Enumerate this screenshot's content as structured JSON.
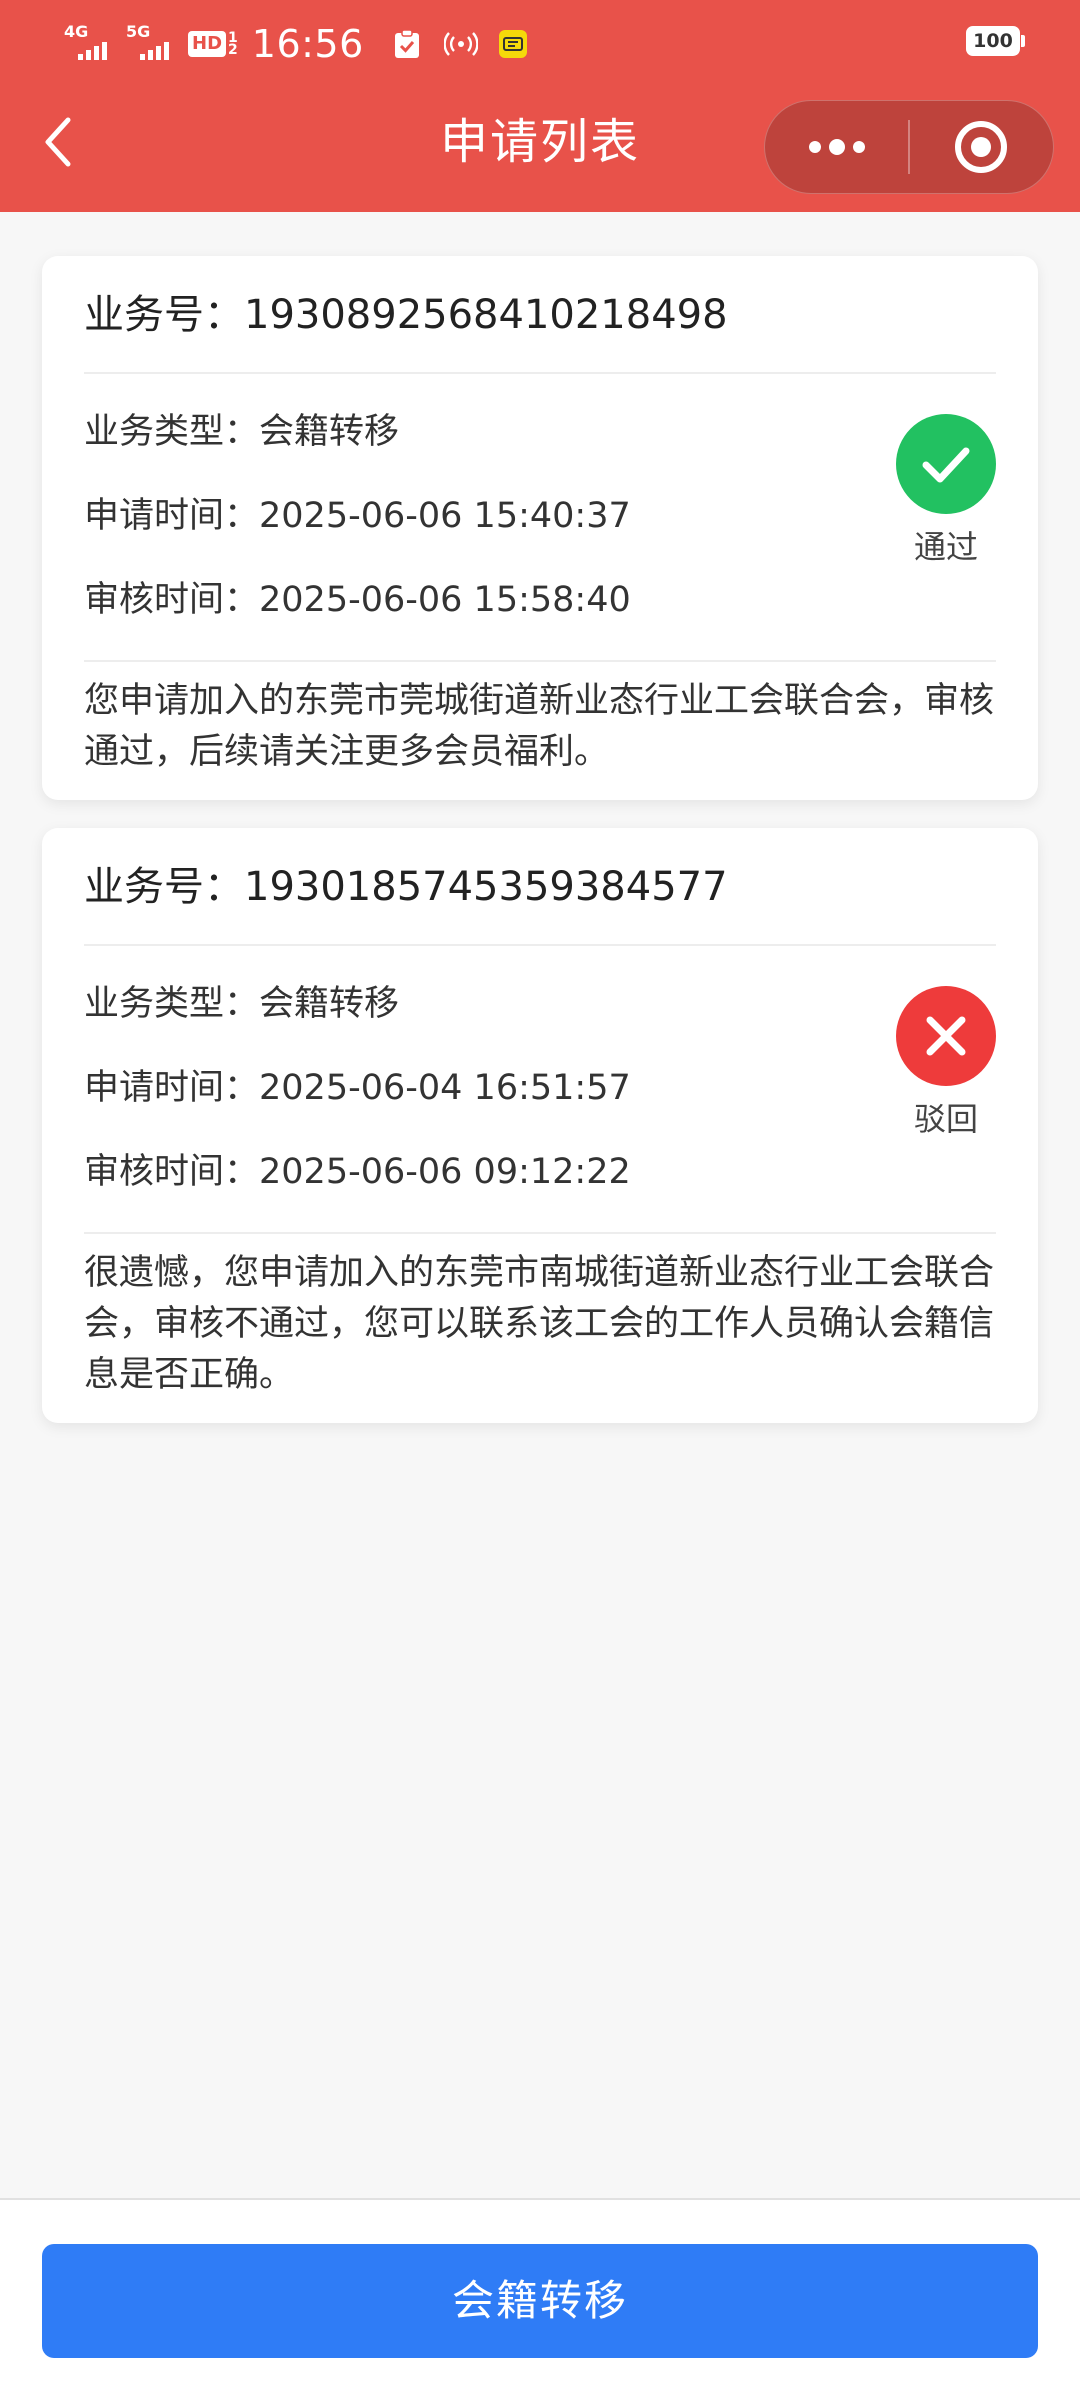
{
  "colors": {
    "brand": "#e8524a",
    "primary": "#2f7cf6",
    "approved": "#22c161",
    "rejected": "#ee3b3b"
  },
  "status_bar": {
    "network_1": "4G",
    "network_2": "5G",
    "hd_label": "HD",
    "hd_sub_1": "1",
    "hd_sub_2": "2",
    "time": "16:56",
    "battery": "100"
  },
  "nav": {
    "title": "申请列表"
  },
  "applications": [
    {
      "business_no_label": "业务号：",
      "business_no": "1930892568410218498",
      "type_label": "业务类型：",
      "type": "会籍转移",
      "apply_time_label": "申请时间：",
      "apply_time": "2025-06-06 15:40:37",
      "review_time_label": "审核时间：",
      "review_time": "2025-06-06 15:58:40",
      "status": "通过",
      "status_icon": "check-icon",
      "message": "您申请加入的东莞市莞城街道新业态行业工会联合会，审核通过，后续请关注更多会员福利。"
    },
    {
      "business_no_label": "业务号：",
      "business_no": "1930185745359384577",
      "type_label": "业务类型：",
      "type": "会籍转移",
      "apply_time_label": "申请时间：",
      "apply_time": "2025-06-04 16:51:57",
      "review_time_label": "审核时间：",
      "review_time": "2025-06-06 09:12:22",
      "status": "驳回",
      "status_icon": "close-icon",
      "message": "很遗憾，您申请加入的东莞市南城街道新业态行业工会联合会，审核不通过，您可以联系该工会的工作人员确认会籍信息是否正确。"
    }
  ],
  "bottom": {
    "button_label": "会籍转移"
  }
}
